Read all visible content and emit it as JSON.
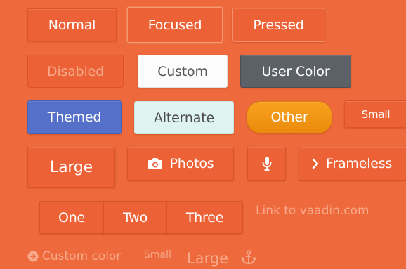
{
  "row1": {
    "normal": "Normal",
    "focused": "Focused",
    "pressed": "Pressed"
  },
  "row2": {
    "disabled": "Disabled",
    "custom": "Custom",
    "user_color": "User Color"
  },
  "row3": {
    "themed": "Themed",
    "alternate": "Alternate",
    "other": "Other",
    "small": "Small"
  },
  "row4": {
    "large": "Large",
    "photos": "Photos",
    "photos_icon": "camera-icon",
    "mic_icon": "microphone-icon",
    "frameless": "Frameless",
    "frameless_icon": "chevron-right-icon"
  },
  "segmented": {
    "one": "One",
    "two": "Two",
    "three": "Three"
  },
  "links": {
    "vaadin": "Link to vaadin.com",
    "custom_color": "Custom color",
    "custom_color_icon": "arrow-circle-right-icon",
    "small": "Small",
    "large": "Large",
    "anchor_icon": "anchor-icon"
  },
  "colors": {
    "background": "#ee6a3c",
    "button": "#ec6236",
    "user_color": "#5c6168",
    "themed": "#5470c8",
    "alternate": "#dff4f0",
    "other": "#f29414",
    "link": "#f6a98b"
  }
}
